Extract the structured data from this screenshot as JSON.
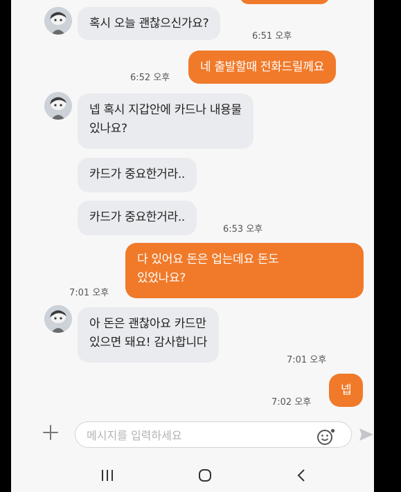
{
  "colors": {
    "accent": "#f07a2a",
    "incoming_bubble": "#eaebee",
    "background": "#f7f7f7"
  },
  "messages": [
    {
      "from": "them",
      "text": "혹시 오늘 괜찮으신가요?",
      "time": "6:51 오후"
    },
    {
      "from": "me",
      "text": "네 출발할때 전화드릴께요",
      "time": "6:52 오후"
    },
    {
      "from": "them",
      "text": "넵 혹시 지갑안에 카드나 내용물\n있나요?",
      "time": ""
    },
    {
      "from": "them",
      "text": "카드가 중요한거라..",
      "time": ""
    },
    {
      "from": "them",
      "text": "카드가 중요한거라..",
      "time": "6:53 오후"
    },
    {
      "from": "me",
      "text": "다 있어요 돈은 업는데요 돈도\n있었나요?",
      "time": "7:01 오후"
    },
    {
      "from": "them",
      "text": "아 돈은 괜찮아요 카드만\n있으면 돼요! 감사합니다",
      "time": "7:01 오후"
    },
    {
      "from": "me",
      "text": "넵",
      "time": "7:02 오후"
    }
  ],
  "input": {
    "placeholder": "메시지를 입력하세요",
    "value": ""
  },
  "icons": {
    "attach": "plus-icon",
    "emoji": "emoji-icon",
    "send": "send-icon",
    "nav_recents": "recent-apps-icon",
    "nav_home": "home-icon",
    "nav_back": "back-icon"
  }
}
